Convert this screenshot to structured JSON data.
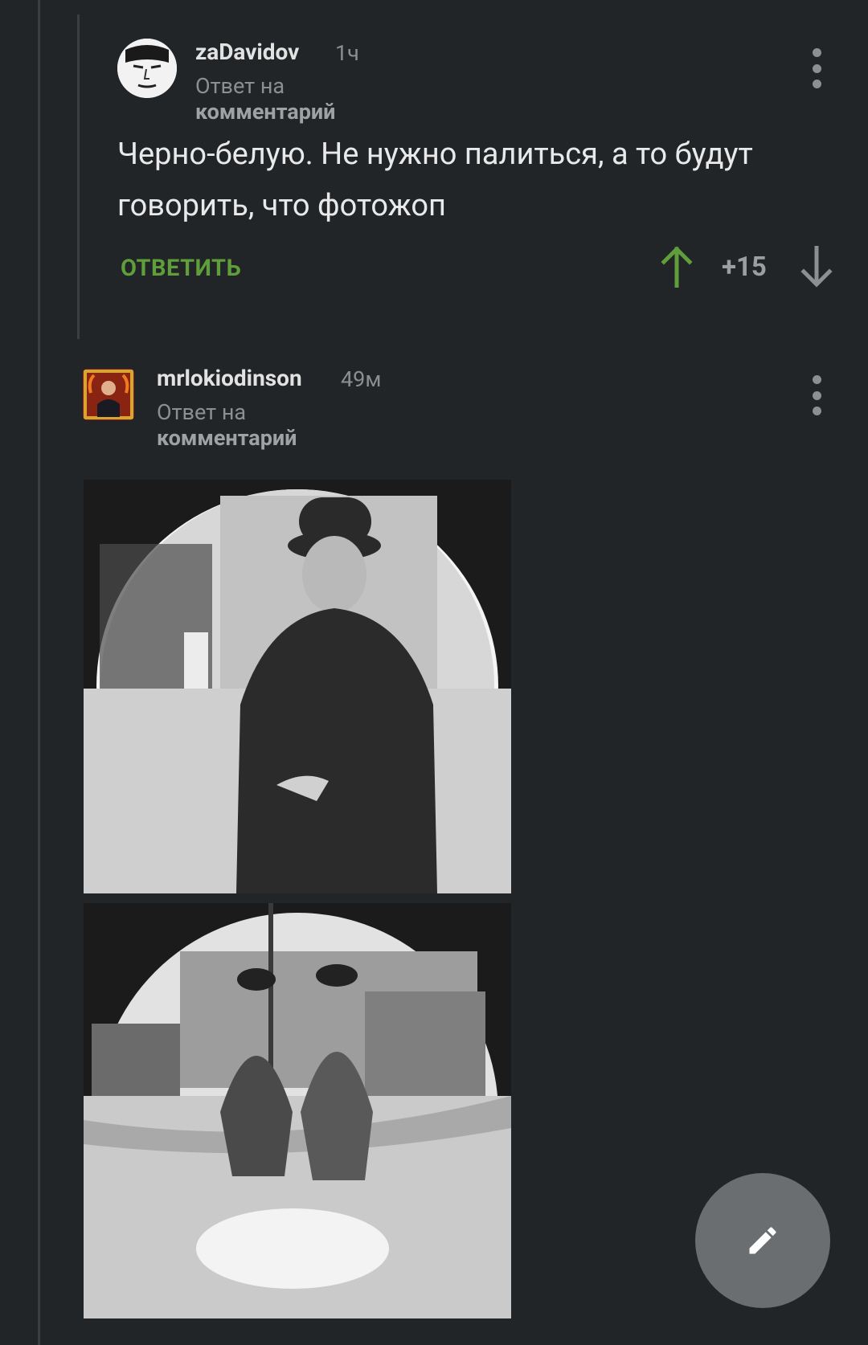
{
  "comments": [
    {
      "author": "zaDavidov",
      "time": "1ч",
      "reply_prefix": "Ответ на",
      "reply_target": "комментарий",
      "text": "Черно-белую. Не нужно палиться, а то будут говорить, что фотожоп",
      "reply_label": "ОТВЕТИТЬ",
      "score": "+15"
    },
    {
      "author": "mrlokiodinson",
      "time": "49м",
      "reply_prefix": "Ответ на",
      "reply_target": "комментарий"
    }
  ],
  "colors": {
    "background": "#212527",
    "accent_green": "#5f9e3a",
    "muted_text": "#8c8f91",
    "fab": "#6b6e70"
  },
  "icons": {
    "upvote": "arrow-up-icon",
    "downvote": "arrow-down-icon",
    "more": "more-vertical-icon",
    "fab": "pencil-icon"
  }
}
